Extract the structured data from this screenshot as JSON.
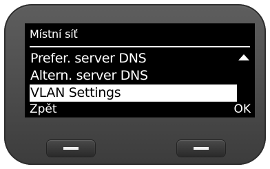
{
  "screen": {
    "title": "Místní síť",
    "menu_items": [
      {
        "label": "Prefer. server DNS",
        "selected": false
      },
      {
        "label": "Altern. server DNS",
        "selected": false
      },
      {
        "label": "VLAN Settings",
        "selected": true
      }
    ],
    "scroll_indicator_icon": "triangle-up-icon"
  },
  "softkeys": {
    "left_label": "Zpět",
    "right_label": "OK"
  },
  "hardware": {
    "left_key_icon": "dash-icon",
    "right_key_icon": "dash-icon"
  }
}
